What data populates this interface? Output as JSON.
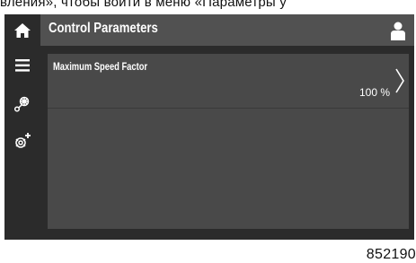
{
  "caption": "вления», чтобы войти в меню «Параметры у",
  "header": {
    "title": "Control Parameters",
    "home_icon": "home-icon",
    "user_icon": "user-icon"
  },
  "sidebar": {
    "items": [
      {
        "icon": "menu-icon"
      },
      {
        "icon": "gear-network-icon"
      },
      {
        "icon": "gear-plus-icon"
      }
    ]
  },
  "parameters": [
    {
      "label": "Maximum Speed Factor",
      "value": "100 %"
    }
  ],
  "figure_code": "852190",
  "colors": {
    "sidebar": "#2b2b2b",
    "header": "#515151",
    "panel": "#494949",
    "text": "#ffffff"
  }
}
